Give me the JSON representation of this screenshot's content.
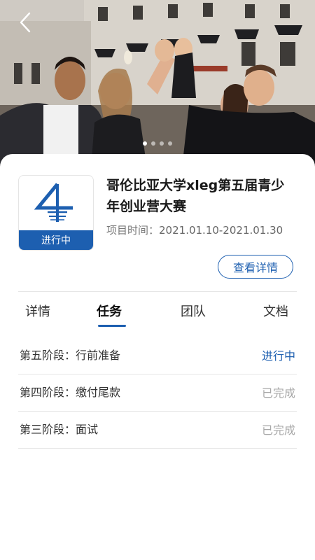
{
  "project": {
    "title": "哥伦比亚大学xleg第五届青少年创业营大赛",
    "status_badge": "进行中",
    "period_label": "项目时间：",
    "period_value": "2021.01.10-2021.01.30",
    "detail_button": "查看详情"
  },
  "carousel": {
    "slide_count": 4,
    "active_index": 0
  },
  "tabs": [
    {
      "label": "详情",
      "active": false
    },
    {
      "label": "任务",
      "active": true
    },
    {
      "label": "团队",
      "active": false
    },
    {
      "label": "文档",
      "active": false
    }
  ],
  "stages": [
    {
      "name": "第五阶段：行前准备",
      "status": "进行中",
      "state": "active"
    },
    {
      "name": "第四阶段：缴付尾款",
      "status": "已完成",
      "state": "done"
    },
    {
      "name": "第三阶段：面试",
      "status": "已完成",
      "state": "done"
    }
  ],
  "colors": {
    "accent": "#1d5fb0",
    "done_text": "#a8a8a8"
  },
  "icons": {
    "back": "chevron-left-icon",
    "logo": "project-logo-icon"
  }
}
